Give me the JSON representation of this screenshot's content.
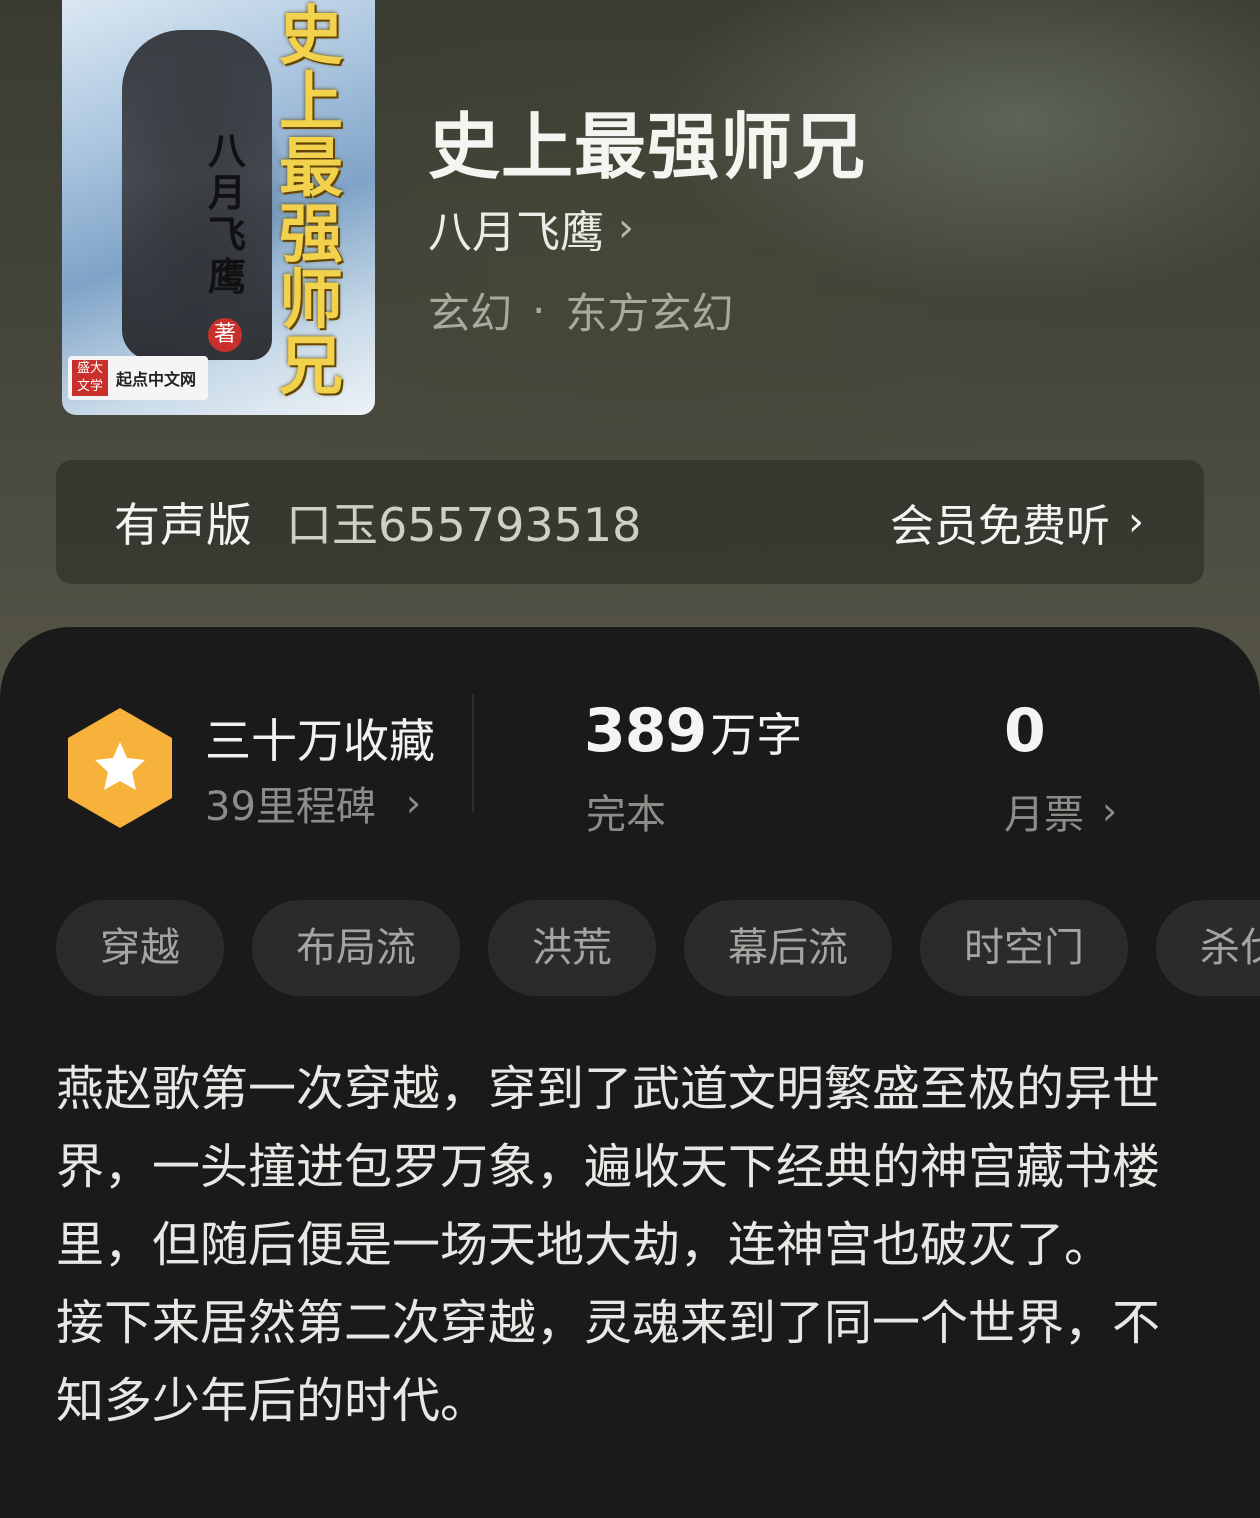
{
  "book": {
    "cover": {
      "title_chars": [
        "史",
        "上",
        "最",
        "强",
        "师",
        "兄"
      ],
      "author_chars": [
        "八",
        "月",
        "飞",
        "鹰"
      ],
      "seal": "著",
      "publisher_badge": "盛大文学",
      "publisher_name": "起点中文网"
    },
    "title": "史上最强师兄",
    "author": "八月飞鹰",
    "genre_primary": "玄幻",
    "genre_separator": "·",
    "genre_secondary": "东方玄幻"
  },
  "audio": {
    "label": "有声版",
    "narrator": "口玉655793518",
    "cta": "会员免费听",
    "chevron": "›"
  },
  "stats": {
    "badge_icon": "star-icon",
    "collection_title": "三十万收藏",
    "milestone": "39里程碑",
    "word_count_number": "389",
    "word_count_unit": "万字",
    "status": "完本",
    "monthly_votes": "0",
    "monthly_votes_label": "月票"
  },
  "tags": [
    "穿越",
    "布局流",
    "洪荒",
    "幕后流",
    "时空门",
    "杀伐"
  ],
  "synopsis": [
    "燕赵歌第一次穿越，穿到了武道文明繁盛至极的异世界，一头撞进包罗万象，遍收天下经典的神宫藏书楼里，但随后便是一场天地大劫，连神宫也破灭了。",
    "接下来居然第二次穿越，灵魂来到了同一个世界，不知多少年后的时代。"
  ],
  "colors": {
    "accent_badge": "#f7b23b",
    "sheet_background": "#1a1a1a",
    "tag_background": "#2b2b2b"
  }
}
